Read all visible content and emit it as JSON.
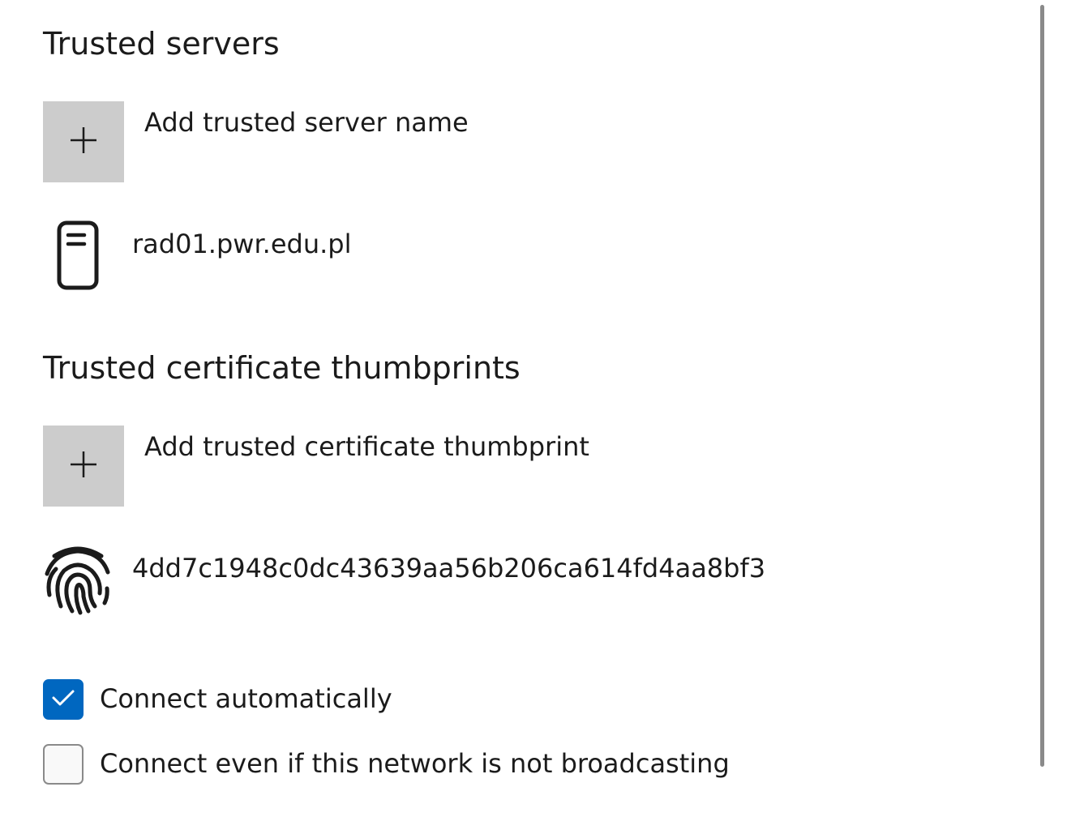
{
  "trusted_servers": {
    "title": "Trusted servers",
    "add_label": "Add trusted server name",
    "add_icon": "plus-icon",
    "items": [
      {
        "icon": "server-icon",
        "name": "rad01.pwr.edu.pl"
      }
    ]
  },
  "trusted_thumbprints": {
    "title": "Trusted certificate thumbprints",
    "add_label": "Add trusted certificate thumbprint",
    "add_icon": "plus-icon",
    "items": [
      {
        "icon": "fingerprint-icon",
        "value": "4dd7c1948c0dc43639aa56b206ca614fd4aa8bf3"
      }
    ]
  },
  "options": {
    "connect_automatically": {
      "label": "Connect automatically",
      "checked": true
    },
    "connect_not_broadcasting": {
      "label": "Connect even if this network is not broadcasting",
      "checked": false
    }
  },
  "colors": {
    "accent": "#0067c0",
    "add_button_bg": "#cccccc",
    "text": "#1b1b1b"
  }
}
